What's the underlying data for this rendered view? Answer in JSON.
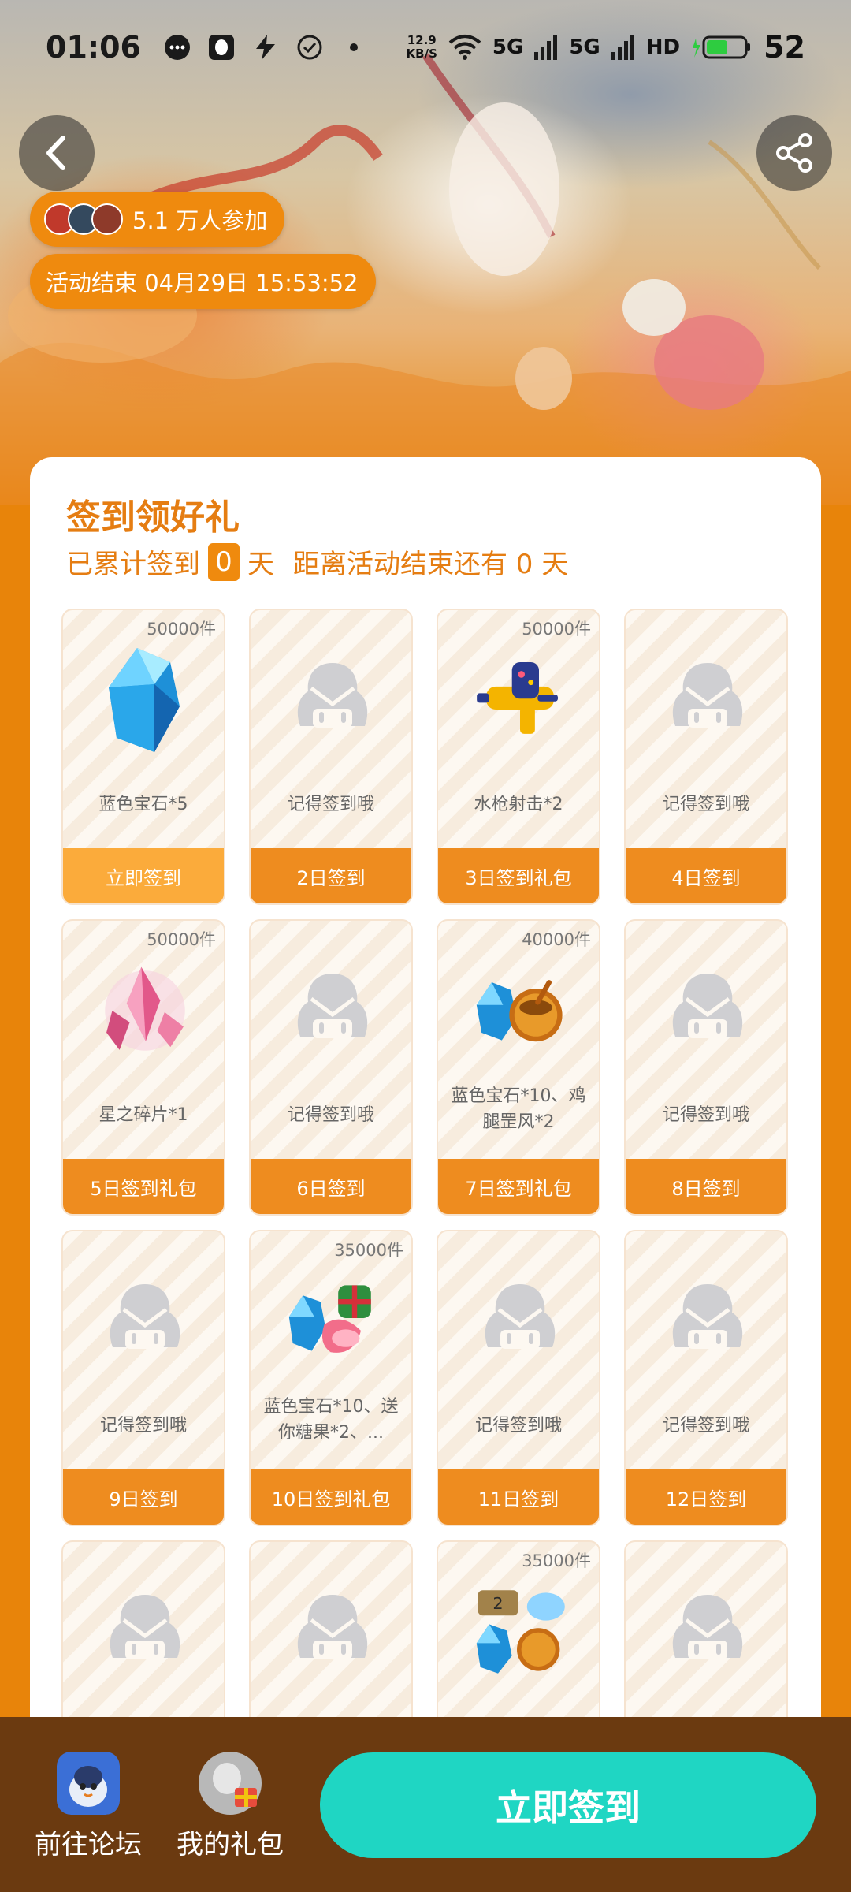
{
  "status_bar": {
    "time": "01:06",
    "net_speed_value": "12.9",
    "net_speed_unit": "KB/S",
    "signal_1": "5G",
    "signal_2": "5G",
    "hd_label": "HD",
    "battery": "52"
  },
  "hero": {
    "participants": "5.1 万人参加",
    "end_time": "活动结束 04月29日 15:53:52"
  },
  "card": {
    "title": "签到领好礼",
    "summary_prefix": "已累计签到",
    "signed_days": "0",
    "summary_days_unit": "天",
    "remaining_text": "距离活动结束还有 0 天"
  },
  "tiles": [
    {
      "stock": "50000件",
      "name": "蓝色宝石*5",
      "button": "立即签到",
      "icon": "blue-gem-icon"
    },
    {
      "stock": "",
      "name": "记得签到哦",
      "button": "2日签到",
      "icon": "placeholder-icon"
    },
    {
      "stock": "50000件",
      "name": "水枪射击*2",
      "button": "3日签到礼包",
      "icon": "water-gun-icon"
    },
    {
      "stock": "",
      "name": "记得签到哦",
      "button": "4日签到",
      "icon": "placeholder-icon"
    },
    {
      "stock": "50000件",
      "name": "星之碎片*1",
      "button": "5日签到礼包",
      "icon": "star-shard-icon"
    },
    {
      "stock": "",
      "name": "记得签到哦",
      "button": "6日签到",
      "icon": "placeholder-icon"
    },
    {
      "stock": "40000件",
      "name": "蓝色宝石*10、鸡腿罡风*2",
      "button": "7日签到礼包",
      "icon": "gem-and-pot-icon"
    },
    {
      "stock": "",
      "name": "记得签到哦",
      "button": "8日签到",
      "icon": "placeholder-icon"
    },
    {
      "stock": "",
      "name": "记得签到哦",
      "button": "9日签到",
      "icon": "placeholder-icon"
    },
    {
      "stock": "35000件",
      "name": "蓝色宝石*10、送你糖果*2、...",
      "button": "10日签到礼包",
      "icon": "gem-and-candy-icon"
    },
    {
      "stock": "",
      "name": "记得签到哦",
      "button": "11日签到",
      "icon": "placeholder-icon"
    },
    {
      "stock": "",
      "name": "记得签到哦",
      "button": "12日签到",
      "icon": "placeholder-icon"
    },
    {
      "stock": "",
      "name": "",
      "button": "",
      "icon": "placeholder-icon"
    },
    {
      "stock": "",
      "name": "",
      "button": "",
      "icon": "placeholder-icon"
    },
    {
      "stock": "35000件",
      "name": "",
      "button": "",
      "icon": "badge-gem-pot-icon"
    },
    {
      "stock": "",
      "name": "",
      "button": "",
      "icon": "placeholder-icon"
    }
  ],
  "bottom_bar": {
    "forum_label": "前往论坛",
    "gifts_label": "我的礼包",
    "cta_label": "立即签到"
  },
  "colors": {
    "accent": "#ee8c1f",
    "background": "#e8840a",
    "cta": "#1fd6c3",
    "bottom_bar": "#6b3a10"
  }
}
